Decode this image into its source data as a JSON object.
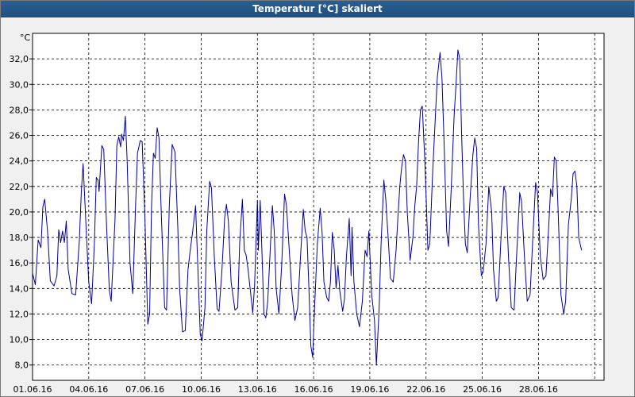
{
  "window": {
    "title": "Temperatur [°C] skaliert"
  },
  "chart_data": {
    "type": "line",
    "title": "Temperatur [°C] skaliert",
    "ylabel": "°C",
    "xlabel": "",
    "ylim": [
      6.8,
      34.0
    ],
    "yticks": [
      8.0,
      10.0,
      12.0,
      14.0,
      16.0,
      18.0,
      20.0,
      22.0,
      24.0,
      26.0,
      28.0,
      30.0,
      32.0
    ],
    "ytick_labels": [
      "8,0",
      "10,0",
      "12,0",
      "14,0",
      "16,0",
      "18,0",
      "20,0",
      "22,0",
      "24,0",
      "26,0",
      "28,0",
      "30,0",
      "32,0"
    ],
    "xlim": [
      0,
      30.5
    ],
    "xticks": [
      0,
      3,
      6,
      9,
      12,
      15,
      18,
      21,
      24,
      27
    ],
    "xtick_labels": [
      "01.06.16",
      "04.06.16",
      "07.06.16",
      "10.06.16",
      "13.06.16",
      "16.06.16",
      "19.06.16",
      "22.06.16",
      "25.06.16",
      "28.06.16"
    ],
    "xgrid": [
      0,
      3,
      6,
      9,
      12,
      15,
      18,
      21,
      24,
      27,
      30
    ],
    "grid": true,
    "line_color": "#000099",
    "series": [
      {
        "values": [
          [
            0.0,
            15.2
          ],
          [
            0.15,
            14.3
          ],
          [
            0.3,
            17.8
          ],
          [
            0.45,
            17.2
          ],
          [
            0.55,
            20.4
          ],
          [
            0.65,
            21.0
          ],
          [
            0.8,
            18.5
          ],
          [
            0.95,
            14.6
          ],
          [
            1.15,
            14.2
          ],
          [
            1.3,
            15.0
          ],
          [
            1.4,
            18.6
          ],
          [
            1.5,
            17.6
          ],
          [
            1.6,
            18.5
          ],
          [
            1.7,
            17.6
          ],
          [
            1.8,
            19.3
          ],
          [
            1.9,
            15.5
          ],
          [
            2.1,
            13.6
          ],
          [
            2.3,
            13.5
          ],
          [
            2.5,
            17.8
          ],
          [
            2.6,
            21.5
          ],
          [
            2.7,
            23.8
          ],
          [
            2.85,
            19.0
          ],
          [
            3.0,
            14.5
          ],
          [
            3.15,
            12.8
          ],
          [
            3.3,
            17.5
          ],
          [
            3.4,
            22.7
          ],
          [
            3.5,
            22.5
          ],
          [
            3.55,
            21.6
          ],
          [
            3.7,
            25.2
          ],
          [
            3.8,
            24.9
          ],
          [
            3.95,
            19.0
          ],
          [
            4.1,
            13.8
          ],
          [
            4.2,
            13.0
          ],
          [
            4.4,
            19.4
          ],
          [
            4.5,
            25.2
          ],
          [
            4.6,
            25.9
          ],
          [
            4.7,
            25.1
          ],
          [
            4.75,
            26.1
          ],
          [
            4.85,
            25.6
          ],
          [
            4.95,
            27.5
          ],
          [
            5.05,
            24.0
          ],
          [
            5.2,
            16.0
          ],
          [
            5.35,
            13.6
          ],
          [
            5.5,
            20.5
          ],
          [
            5.6,
            24.6
          ],
          [
            5.75,
            25.6
          ],
          [
            5.85,
            25.5
          ],
          [
            6.0,
            19.5
          ],
          [
            6.15,
            11.2
          ],
          [
            6.25,
            12.0
          ],
          [
            6.35,
            20.4
          ],
          [
            6.45,
            24.6
          ],
          [
            6.55,
            24.2
          ],
          [
            6.65,
            26.6
          ],
          [
            6.75,
            25.8
          ],
          [
            6.85,
            20.8
          ],
          [
            7.05,
            12.5
          ],
          [
            7.15,
            12.3
          ],
          [
            7.3,
            20.5
          ],
          [
            7.45,
            25.3
          ],
          [
            7.6,
            24.7
          ],
          [
            7.75,
            18.8
          ],
          [
            7.85,
            14.0
          ],
          [
            8.0,
            10.6
          ],
          [
            8.15,
            10.7
          ],
          [
            8.3,
            15.5
          ],
          [
            8.4,
            16.8
          ],
          [
            8.55,
            18.5
          ],
          [
            8.7,
            20.5
          ],
          [
            8.8,
            16.6
          ],
          [
            8.95,
            10.4
          ],
          [
            9.05,
            9.9
          ],
          [
            9.2,
            12.5
          ],
          [
            9.3,
            18.5
          ],
          [
            9.45,
            22.4
          ],
          [
            9.55,
            21.9
          ],
          [
            9.7,
            16.5
          ],
          [
            9.85,
            12.4
          ],
          [
            9.95,
            12.2
          ],
          [
            10.1,
            15.2
          ],
          [
            10.25,
            19.5
          ],
          [
            10.35,
            20.6
          ],
          [
            10.45,
            19.3
          ],
          [
            10.6,
            14.5
          ],
          [
            10.8,
            12.3
          ],
          [
            10.95,
            12.5
          ],
          [
            11.05,
            17.5
          ],
          [
            11.2,
            21.0
          ],
          [
            11.3,
            17.0
          ],
          [
            11.4,
            16.6
          ],
          [
            11.5,
            15.5
          ],
          [
            11.65,
            13.5
          ],
          [
            11.75,
            12.1
          ],
          [
            11.85,
            14.2
          ],
          [
            12.0,
            20.9
          ],
          [
            12.05,
            17.0
          ],
          [
            12.15,
            20.9
          ],
          [
            12.25,
            16.5
          ],
          [
            12.35,
            12.0
          ],
          [
            12.45,
            11.7
          ],
          [
            12.55,
            13.0
          ],
          [
            12.7,
            17.5
          ],
          [
            12.8,
            20.5
          ],
          [
            12.9,
            18.5
          ],
          [
            13.0,
            14.0
          ],
          [
            13.15,
            12.0
          ],
          [
            13.3,
            16.0
          ],
          [
            13.45,
            21.4
          ],
          [
            13.55,
            20.5
          ],
          [
            13.7,
            17.0
          ],
          [
            13.85,
            13.5
          ],
          [
            14.0,
            11.5
          ],
          [
            14.15,
            12.5
          ],
          [
            14.3,
            16.5
          ],
          [
            14.45,
            20.2
          ],
          [
            14.55,
            18.5
          ],
          [
            14.65,
            18.0
          ],
          [
            14.75,
            14.0
          ],
          [
            14.85,
            9.5
          ],
          [
            14.95,
            8.6
          ],
          [
            15.05,
            12.5
          ],
          [
            15.2,
            17.5
          ],
          [
            15.35,
            20.3
          ],
          [
            15.45,
            18.5
          ],
          [
            15.55,
            14.5
          ],
          [
            15.7,
            13.3
          ],
          [
            15.8,
            13.0
          ],
          [
            15.9,
            14.5
          ],
          [
            16.0,
            18.4
          ],
          [
            16.1,
            17.0
          ],
          [
            16.2,
            14.0
          ],
          [
            16.3,
            15.8
          ],
          [
            16.4,
            13.8
          ],
          [
            16.55,
            12.2
          ],
          [
            16.65,
            13.2
          ],
          [
            16.75,
            16.5
          ],
          [
            16.9,
            19.5
          ],
          [
            17.0,
            15.0
          ],
          [
            17.05,
            18.8
          ],
          [
            17.15,
            14.5
          ],
          [
            17.3,
            12.0
          ],
          [
            17.45,
            11.0
          ],
          [
            17.6,
            13.0
          ],
          [
            17.75,
            17.0
          ],
          [
            17.85,
            16.5
          ],
          [
            17.95,
            18.5
          ],
          [
            18.1,
            13.5
          ],
          [
            18.25,
            11.5
          ],
          [
            18.35,
            8.0
          ],
          [
            18.5,
            12.5
          ],
          [
            18.6,
            17.5
          ],
          [
            18.75,
            22.5
          ],
          [
            18.85,
            21.0
          ],
          [
            19.0,
            17.5
          ],
          [
            19.1,
            14.8
          ],
          [
            19.25,
            14.5
          ],
          [
            19.4,
            17.0
          ],
          [
            19.5,
            19.6
          ],
          [
            19.6,
            22.0
          ],
          [
            19.7,
            23.5
          ],
          [
            19.8,
            24.5
          ],
          [
            19.9,
            24.0
          ],
          [
            20.0,
            20.0
          ],
          [
            20.15,
            16.2
          ],
          [
            20.3,
            18.0
          ],
          [
            20.4,
            20.5
          ],
          [
            20.5,
            22.0
          ],
          [
            20.6,
            25.5
          ],
          [
            20.7,
            28.0
          ],
          [
            20.8,
            28.3
          ],
          [
            20.95,
            23.5
          ],
          [
            21.1,
            17.0
          ],
          [
            21.2,
            17.5
          ],
          [
            21.35,
            23.0
          ],
          [
            21.5,
            27.5
          ],
          [
            21.6,
            30.5
          ],
          [
            21.75,
            32.5
          ],
          [
            21.85,
            30.5
          ],
          [
            21.95,
            26.0
          ],
          [
            22.1,
            18.5
          ],
          [
            22.2,
            17.3
          ],
          [
            22.35,
            22.0
          ],
          [
            22.5,
            27.5
          ],
          [
            22.6,
            30.0
          ],
          [
            22.7,
            32.7
          ],
          [
            22.8,
            32.0
          ],
          [
            22.9,
            26.0
          ],
          [
            23.0,
            21.0
          ],
          [
            23.1,
            17.5
          ],
          [
            23.2,
            16.8
          ],
          [
            23.35,
            21.0
          ],
          [
            23.5,
            24.5
          ],
          [
            23.6,
            25.8
          ],
          [
            23.7,
            25.0
          ],
          [
            23.8,
            19.0
          ],
          [
            23.95,
            15.0
          ],
          [
            24.05,
            15.3
          ],
          [
            24.2,
            17.5
          ],
          [
            24.35,
            22.0
          ],
          [
            24.5,
            20.0
          ],
          [
            24.6,
            15.5
          ],
          [
            24.75,
            13.0
          ],
          [
            24.85,
            13.3
          ],
          [
            25.0,
            18.0
          ],
          [
            25.15,
            22.0
          ],
          [
            25.25,
            21.5
          ],
          [
            25.4,
            16.5
          ],
          [
            25.55,
            12.5
          ],
          [
            25.7,
            12.3
          ],
          [
            25.8,
            15.5
          ],
          [
            26.0,
            21.5
          ],
          [
            26.1,
            20.8
          ],
          [
            26.25,
            16.5
          ],
          [
            26.4,
            13.0
          ],
          [
            26.55,
            13.5
          ],
          [
            26.7,
            18.0
          ],
          [
            26.85,
            22.3
          ],
          [
            26.95,
            21.5
          ],
          [
            27.1,
            16.5
          ],
          [
            27.25,
            14.7
          ],
          [
            27.4,
            15.0
          ],
          [
            27.55,
            19.0
          ],
          [
            27.65,
            21.8
          ],
          [
            27.75,
            21.2
          ],
          [
            27.85,
            24.3
          ],
          [
            27.95,
            24.0
          ],
          [
            28.05,
            20.0
          ],
          [
            28.2,
            13.5
          ],
          [
            28.35,
            12.0
          ],
          [
            28.45,
            13.0
          ],
          [
            28.6,
            19.0
          ],
          [
            28.75,
            21.0
          ],
          [
            28.85,
            23.0
          ],
          [
            28.95,
            23.2
          ],
          [
            29.05,
            22.0
          ],
          [
            29.15,
            18.0
          ],
          [
            29.3,
            17.0
          ]
        ]
      }
    ]
  }
}
